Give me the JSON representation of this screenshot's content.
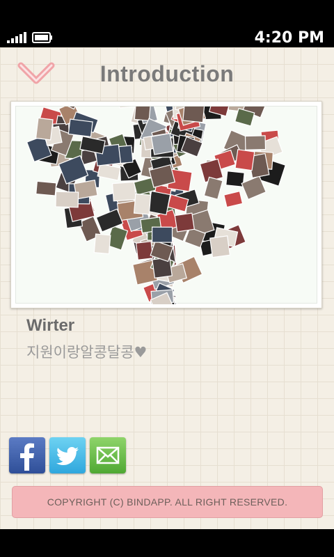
{
  "status_bar": {
    "time": "4:20 PM",
    "icons": [
      "signal-icon",
      "battery-icon"
    ]
  },
  "header": {
    "title": "Introduction",
    "back_icon": "heart-chevron-icon"
  },
  "photo": {
    "description_icon": "heart-photo-collage"
  },
  "writer": {
    "label": "Wirter",
    "name": "지원이랑알콩달콩♥"
  },
  "share": {
    "buttons": [
      {
        "name": "facebook-icon"
      },
      {
        "name": "twitter-icon"
      },
      {
        "name": "email-icon"
      }
    ]
  },
  "footer": {
    "copyright": "COPYRIGHT (C)  BINDAPP. ALL RIGHT RESERVED."
  },
  "colors": {
    "background": "#f4efe5",
    "accent_pink": "#f4b6b9",
    "title_gray": "#7a7a7a",
    "facebook_blue": "#3b5998",
    "twitter_blue": "#3fb4e6",
    "email_green": "#5cb83d"
  }
}
